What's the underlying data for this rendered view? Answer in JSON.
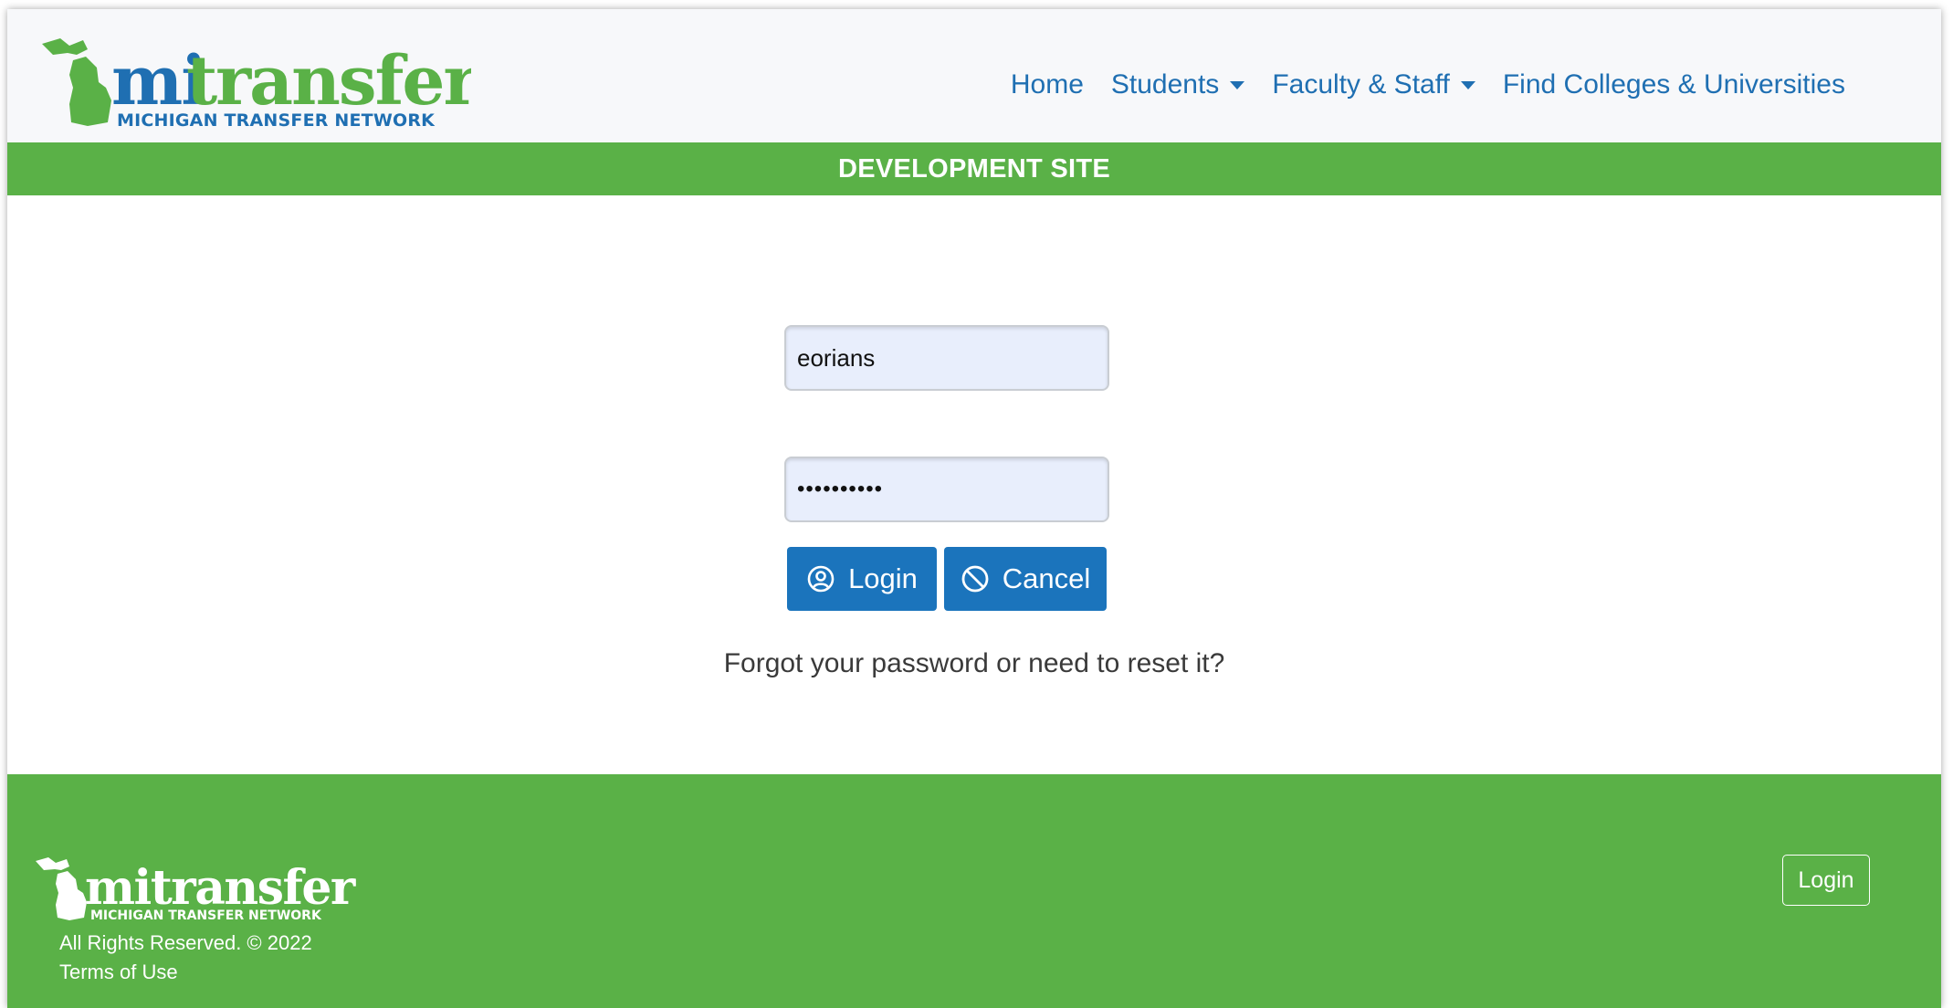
{
  "header": {
    "logo": {
      "wordmark": "mitransfer",
      "tagline": "MICHIGAN TRANSFER NETWORK",
      "mi_color": "#1f6fb2",
      "transfer_color": "#5ab147"
    },
    "nav": [
      {
        "label": "Home"
      },
      {
        "label": "Students",
        "dropdown": true
      },
      {
        "label": "Faculty & Staff",
        "dropdown": true
      },
      {
        "label": "Find Colleges & Universities"
      }
    ]
  },
  "banner": {
    "text": "DEVELOPMENT SITE",
    "color": "#5ab147"
  },
  "form": {
    "username_value": "eorians",
    "password_value": "••••••••••",
    "login_label": "Login",
    "login_icon": "user-circle-icon",
    "cancel_label": "Cancel",
    "cancel_icon": "ban-icon",
    "button_color": "#1b74bc",
    "forgot_text": "Forgot your password or need to reset it?"
  },
  "footer": {
    "logo_wordmark": "mitransfer",
    "logo_tagline": "MICHIGAN TRANSFER NETWORK",
    "copyright": "All Rights Reserved. © 2022",
    "terms": "Terms of Use",
    "login_label": "Login",
    "color": "#5ab147"
  }
}
